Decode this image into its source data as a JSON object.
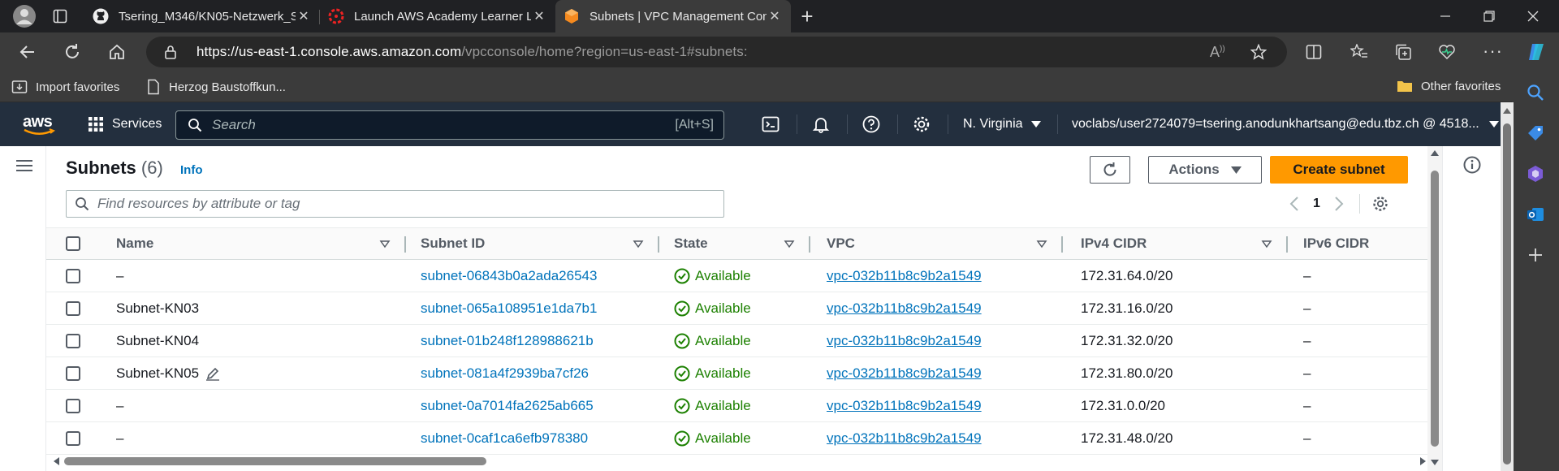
{
  "browser": {
    "tabs": [
      {
        "title": "Tsering_M346/KN05-Netzwerk_S",
        "icon": "github-icon"
      },
      {
        "title": "Launch AWS Academy Learner La",
        "icon": "canvas-icon"
      },
      {
        "title": "Subnets | VPC Management Con",
        "icon": "aws-vpc-icon",
        "active": true
      }
    ],
    "url_host": "https://us-east-1.console.aws.amazon.com",
    "url_path": "/vpcconsole/home?region=us-east-1#subnets:",
    "favorites": [
      {
        "label": "Import favorites",
        "icon": "import-icon"
      },
      {
        "label": "Herzog Baustoffkun...",
        "icon": "page-icon"
      }
    ],
    "other_favorites": "Other favorites"
  },
  "aws": {
    "logo": "aws",
    "services": "Services",
    "search_placeholder": "Search",
    "search_shortcut": "[Alt+S]",
    "region": "N. Virginia",
    "account": "voclabs/user2724079=tsering.anodunkhartsang@edu.tbz.ch @ 4518..."
  },
  "subnets": {
    "title": "Subnets",
    "count": "(6)",
    "info": "Info",
    "actions": "Actions",
    "create": "Create subnet",
    "filter_placeholder": "Find resources by attribute or tag",
    "page": "1",
    "columns": [
      "Name",
      "Subnet ID",
      "State",
      "VPC",
      "IPv4 CIDR",
      "IPv6 CIDR"
    ],
    "rows": [
      {
        "name": "–",
        "id": "subnet-06843b0a2ada26543",
        "state": "Available",
        "vpc": "vpc-032b11b8c9b2a1549",
        "ipv4": "172.31.64.0/20",
        "ipv6": "–"
      },
      {
        "name": "Subnet-KN03",
        "id": "subnet-065a108951e1da7b1",
        "state": "Available",
        "vpc": "vpc-032b11b8c9b2a1549",
        "ipv4": "172.31.16.0/20",
        "ipv6": "–"
      },
      {
        "name": "Subnet-KN04",
        "id": "subnet-01b248f128988621b",
        "state": "Available",
        "vpc": "vpc-032b11b8c9b2a1549",
        "ipv4": "172.31.32.0/20",
        "ipv6": "–"
      },
      {
        "name": "Subnet-KN05",
        "id": "subnet-081a4f2939ba7cf26",
        "state": "Available",
        "vpc": "vpc-032b11b8c9b2a1549",
        "ipv4": "172.31.80.0/20",
        "ipv6": "–"
      },
      {
        "name": "–",
        "id": "subnet-0a7014fa2625ab665",
        "state": "Available",
        "vpc": "vpc-032b11b8c9b2a1549",
        "ipv4": "172.31.0.0/20",
        "ipv6": "–"
      },
      {
        "name": "–",
        "id": "subnet-0caf1ca6efb978380",
        "state": "Available",
        "vpc": "vpc-032b11b8c9b2a1549",
        "ipv4": "172.31.48.0/20",
        "ipv6": "–"
      }
    ]
  },
  "colors": {
    "aws_nav": "#232f3e",
    "primary": "#ff9900",
    "link": "#0073bb",
    "success": "#1d8102"
  }
}
